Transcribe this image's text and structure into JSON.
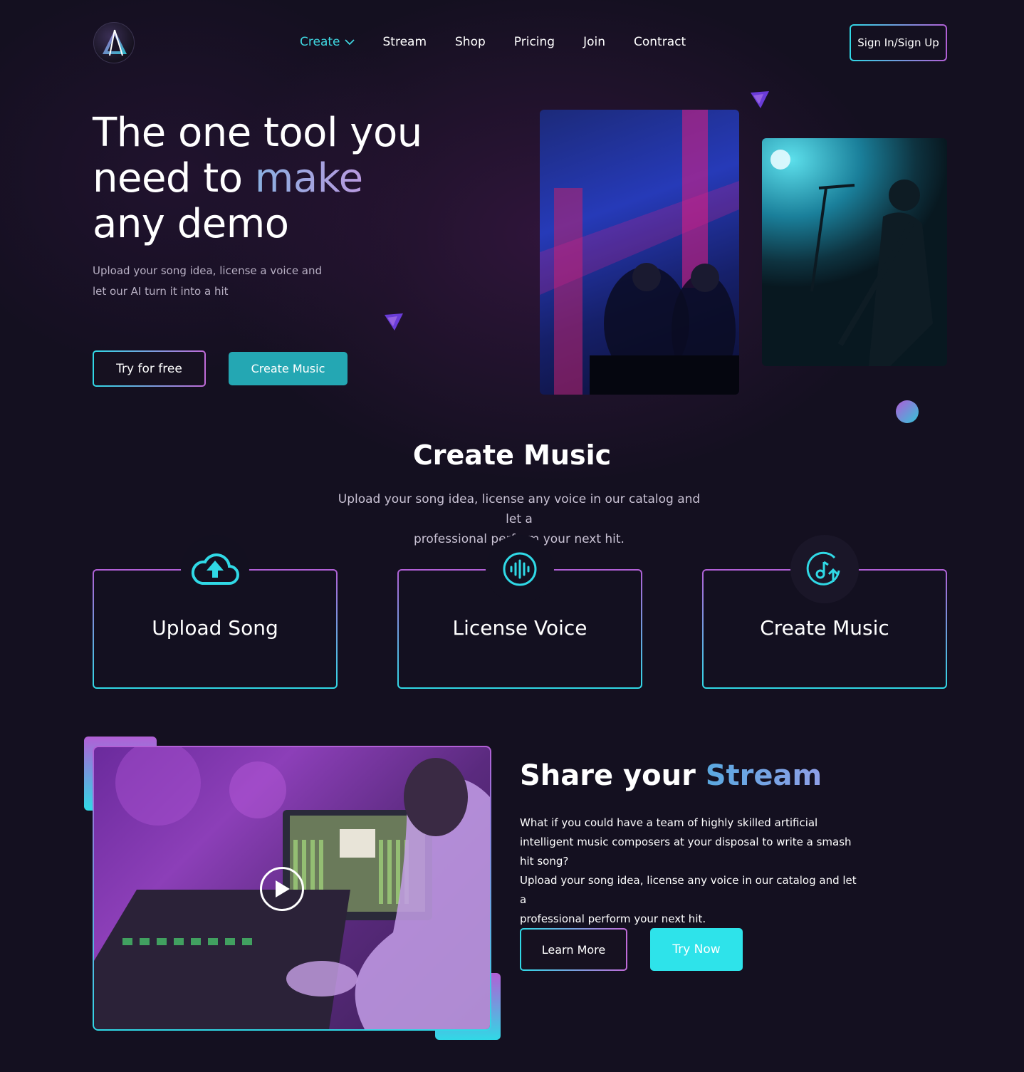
{
  "header": {
    "logo_icon": "triangle-logo-icon",
    "nav": [
      {
        "label": "Create",
        "active": true,
        "dropdown": true
      },
      {
        "label": "Stream"
      },
      {
        "label": "Shop"
      },
      {
        "label": "Pricing"
      },
      {
        "label": "Join"
      },
      {
        "label": "Contract"
      }
    ],
    "signin_label": "Sign In/Sign Up"
  },
  "hero": {
    "title_line1": "The one tool you",
    "title_line2_plain": "need to ",
    "title_line2_accent": "make",
    "title_line3": "any demo",
    "subtitle_line1": "Upload your song idea, license a voice and",
    "subtitle_line2": "let our AI turn it into a hit",
    "try_free_label": "Try for free",
    "create_music_label": "Create Music"
  },
  "create_section": {
    "title": "Create Music",
    "subtitle_line1": "Upload your song idea, license any voice in our catalog and let a",
    "subtitle_line2": "professional perform your next hit.",
    "cards": [
      {
        "label": "Upload Song",
        "icon": "cloud-upload-icon"
      },
      {
        "label": "License Voice",
        "icon": "sound-wave-icon"
      },
      {
        "label": "Create Music",
        "icon": "music-note-upload-icon"
      }
    ]
  },
  "share_section": {
    "title_plain": "Share your ",
    "title_accent": "Stream",
    "para1_line1": "What if you could have a team of highly skilled artificial",
    "para1_line2": "intelligent music composers at your disposal to write a smash",
    "para1_line3": "hit song?",
    "para2_line1": "Upload your song idea, license any voice in our catalog and let a",
    "para2_line2": "professional perform your next hit.",
    "learn_more_label": "Learn More",
    "try_now_label": "Try Now"
  },
  "colors": {
    "background": "#141020",
    "accent_cyan": "#30d9e6",
    "accent_purple": "#b25fd6",
    "teal_button": "#24a7b3"
  }
}
